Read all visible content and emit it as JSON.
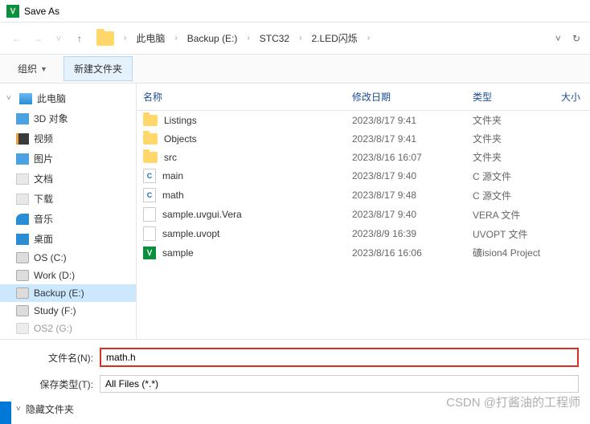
{
  "window": {
    "title": "Save As"
  },
  "breadcrumb": {
    "root": "此电脑",
    "p1": "Backup (E:)",
    "p2": "STC32",
    "p3": "2.LED闪烁"
  },
  "toolbar": {
    "organize": "组织",
    "newfolder": "新建文件夹"
  },
  "sidebar": {
    "pc": "此电脑",
    "d3": "3D 对象",
    "video": "视频",
    "pics": "图片",
    "docs": "文档",
    "downloads": "下载",
    "music": "音乐",
    "desktop": "桌面",
    "c": "OS (C:)",
    "d": "Work (D:)",
    "e": "Backup (E:)",
    "f": "Study (F:)",
    "g": "OS2 (G:)"
  },
  "headers": {
    "name": "名称",
    "date": "修改日期",
    "type": "类型",
    "size": "大小"
  },
  "files": [
    {
      "icon": "folder",
      "name": "Listings",
      "date": "2023/8/17 9:41",
      "type": "文件夹"
    },
    {
      "icon": "folder",
      "name": "Objects",
      "date": "2023/8/17 9:41",
      "type": "文件夹"
    },
    {
      "icon": "folder",
      "name": "src",
      "date": "2023/8/16 16:07",
      "type": "文件夹"
    },
    {
      "icon": "c",
      "name": "main",
      "date": "2023/8/17 9:40",
      "type": "C 源文件"
    },
    {
      "icon": "c",
      "name": "math",
      "date": "2023/8/17 9:48",
      "type": "C 源文件"
    },
    {
      "icon": "file",
      "name": "sample.uvgui.Vera",
      "date": "2023/8/17 9:40",
      "type": "VERA 文件"
    },
    {
      "icon": "file",
      "name": "sample.uvopt",
      "date": "2023/8/9 16:39",
      "type": "UVOPT 文件"
    },
    {
      "icon": "app",
      "name": "sample",
      "date": "2023/8/16 16:06",
      "type": "礦ision4 Project"
    }
  ],
  "fields": {
    "name_label": "文件名(N):",
    "name_value": "math.h",
    "type_label": "保存类型(T):",
    "type_value": "All Files (*.*)"
  },
  "hidefiles": "隐藏文件夹",
  "watermark": "CSDN @打酱油的工程师"
}
